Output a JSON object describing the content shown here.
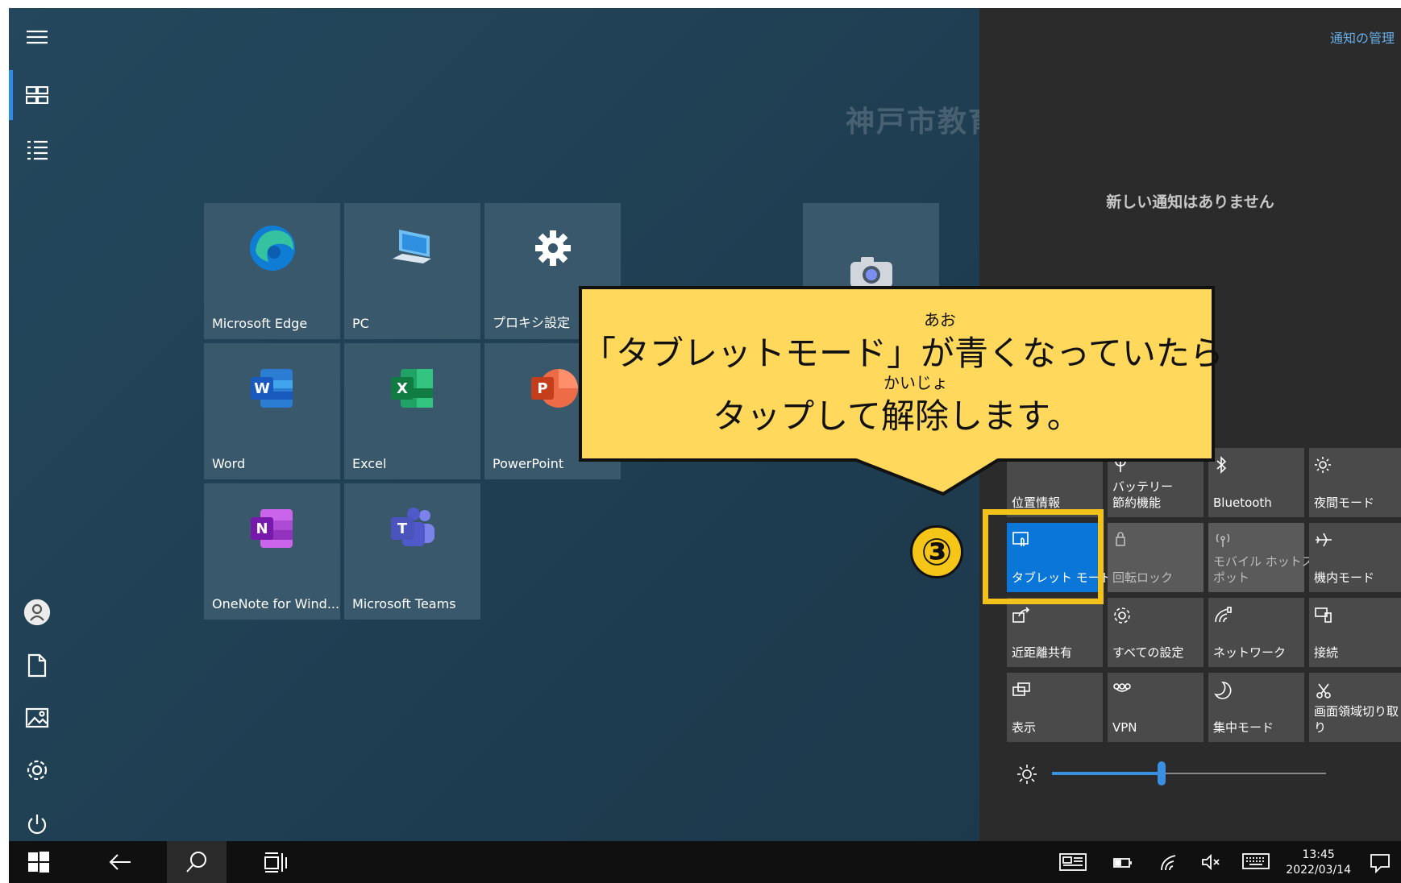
{
  "start": {
    "watermark": "神戸市教育",
    "rail_icons": [
      "hamburger-icon",
      "tiles-icon",
      "list-icon",
      "user-icon",
      "document-icon",
      "pictures-icon",
      "settings-icon",
      "power-icon"
    ],
    "tiles": [
      {
        "label": "Microsoft Edge",
        "icon": "edge-icon"
      },
      {
        "label": "PC",
        "icon": "pc-icon"
      },
      {
        "label": "プロキシ設定",
        "icon": "gear-icon"
      },
      {
        "label": "Word",
        "icon": "word-icon"
      },
      {
        "label": "Excel",
        "icon": "excel-icon"
      },
      {
        "label": "PowerPoint",
        "icon": "powerpoint-icon"
      },
      {
        "label": "OneNote for Wind...",
        "icon": "onenote-icon"
      },
      {
        "label": "Microsoft Teams",
        "icon": "teams-icon"
      },
      {
        "label": "",
        "icon": "camera-icon"
      }
    ]
  },
  "action_center": {
    "manage_link": "通知の管理",
    "empty_message": "新しい通知はありません",
    "quick_actions": [
      {
        "label": "位置情報",
        "state": "hidden"
      },
      {
        "label": "バッテリー\n節約機能",
        "state": "normal"
      },
      {
        "label": "Bluetooth",
        "state": "normal"
      },
      {
        "label": "夜間モード",
        "state": "normal"
      },
      {
        "label": "タブレット モード",
        "state": "active"
      },
      {
        "label": "回転ロック",
        "state": "dim"
      },
      {
        "label": "モバイル ホットス\nポット",
        "state": "dim"
      },
      {
        "label": "機内モード",
        "state": "normal"
      },
      {
        "label": "近距離共有",
        "state": "normal"
      },
      {
        "label": "すべての設定",
        "state": "normal"
      },
      {
        "label": "ネットワーク",
        "state": "normal"
      },
      {
        "label": "接続",
        "state": "normal"
      },
      {
        "label": "表示",
        "state": "normal"
      },
      {
        "label": "VPN",
        "state": "normal"
      },
      {
        "label": "集中モード",
        "state": "normal"
      },
      {
        "label": "画面領域切り取\nり",
        "state": "normal"
      }
    ],
    "brightness_percent": 40
  },
  "callout": {
    "ruby1": "あお",
    "line1": "「タブレットモード」が青くなっていたら",
    "ruby2": "かいじょ",
    "line2": "タップして解除します。",
    "step_badge": "③"
  },
  "taskbar": {
    "time": "13:45",
    "date": "2022/03/14"
  },
  "colors": {
    "accent": "#0a77d8",
    "callout": "#ffd85c",
    "highlight": "#f2c21a"
  }
}
